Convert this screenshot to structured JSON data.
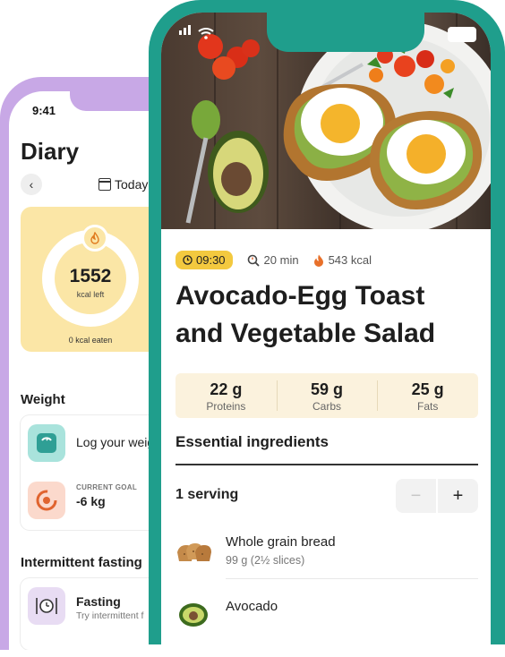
{
  "diary": {
    "status_time": "9:41",
    "title": "Diary",
    "date_label": "Today",
    "calories": {
      "left_value": "1552",
      "left_label": "kcal left",
      "eaten_label": "0 kcal eaten"
    },
    "weight_section": "Weight",
    "log_weight": "Log your weig",
    "goal_label": "CURRENT GOAL",
    "goal_value": "-6 kg",
    "fasting_section": "Intermittent fasting",
    "fasting_title": "Fasting",
    "fasting_sub": "Try intermittent f"
  },
  "recipe": {
    "meal_time": "09:30",
    "prep_time": "20 min",
    "calories": "543 kcal",
    "title": "Avocado-Egg Toast and Vegetable Salad",
    "macros": [
      {
        "value": "22 g",
        "label": "Proteins"
      },
      {
        "value": "59 g",
        "label": "Carbs"
      },
      {
        "value": "25 g",
        "label": "Fats"
      }
    ],
    "ingredients_heading": "Essential ingredients",
    "serving_label": "1 serving",
    "stepper": {
      "minus": "−",
      "plus": "+"
    },
    "ingredients": [
      {
        "name": "Whole grain bread",
        "qty": "99 g (2½ slices)"
      },
      {
        "name": "Avocado",
        "qty": ""
      }
    ]
  },
  "colors": {
    "front_frame": "#1f9e8c",
    "back_frame": "#c8a8e6",
    "calorie_card": "#fbe6a6",
    "time_pill": "#f3c93f",
    "macro_bg": "#fbf2dd"
  }
}
